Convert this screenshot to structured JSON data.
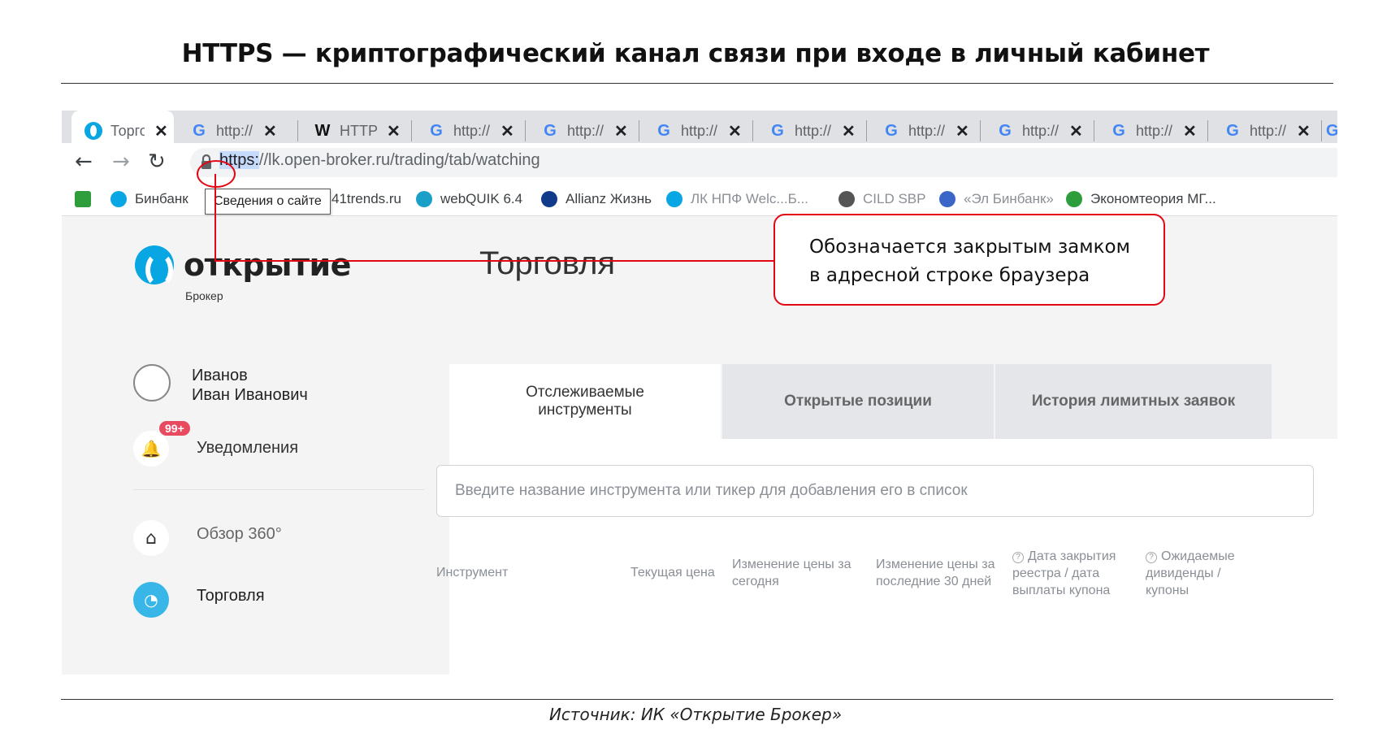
{
  "title": "HTTPS — криптографический канал связи при входе в личный кабинет",
  "source": "Источник: ИК «Открытие Брокер»",
  "browser": {
    "tabs": [
      {
        "icon": "otkritie-icon",
        "label": "Торговля",
        "active": true
      },
      {
        "icon": "google-icon",
        "label": "http://"
      },
      {
        "icon": "wikipedia-icon",
        "label": "HTTPS"
      },
      {
        "icon": "google-icon",
        "label": "http://"
      },
      {
        "icon": "google-icon",
        "label": "http://"
      },
      {
        "icon": "google-icon",
        "label": "http://"
      },
      {
        "icon": "google-icon",
        "label": "http://"
      },
      {
        "icon": "google-icon",
        "label": "http://"
      },
      {
        "icon": "google-icon",
        "label": "http://"
      },
      {
        "icon": "google-icon",
        "label": "http://"
      },
      {
        "icon": "google-icon",
        "label": "http://"
      }
    ],
    "url_scheme": "https:",
    "url_rest": "//lk.open-broker.ru/trading/tab/watching",
    "tooltip": "Сведения о сайте",
    "bookmarks": [
      {
        "label": "",
        "color": "#2e9e3c"
      },
      {
        "label": "Бинбанк",
        "color": "#08a6e3"
      },
      {
        "label": "41trends.ru",
        "color": ""
      },
      {
        "label": "webQUIK 6.4",
        "color": "#1aa0c8"
      },
      {
        "label": "Allianz Жизнь",
        "color": "#113b8a"
      },
      {
        "label": "ЛК НПФ Welc...Б...",
        "color": "#08a6e3"
      },
      {
        "label": "CILD SBP",
        "color": "#555555"
      },
      {
        "label": "«Эл Бинбанк»",
        "color": "#3a67c7"
      },
      {
        "label": "Экономтеория МГ...",
        "color": "#2e9e3c"
      }
    ]
  },
  "app": {
    "logo_text": "открытие",
    "logo_sub": "Брокер",
    "heading": "Торговля",
    "user_name_1": "Иванов",
    "user_name_2": "Иван Иванович",
    "badge": "99+",
    "notifications": "Уведомления",
    "overview": "Обзор 360°",
    "trading": "Торговля",
    "tabs": [
      "Отслеживаемые инструменты",
      "Открытые позиции",
      "История лимитных заявок"
    ],
    "search_placeholder": "Введите название инструмента или тикер для добавления его в список",
    "columns": [
      "Инструмент",
      "Текущая цена",
      "Изменение цены за сегодня",
      "Изменение цены за последние 30 дней",
      "Дата закрытия реестра / дата выплаты купона",
      "Ожидаемые дивиденды / купоны"
    ]
  },
  "callout": {
    "line1": "Обозначается закрытым замком",
    "line2": "в адресной строке браузера"
  },
  "colors": {
    "accent": "#08a6e3",
    "callout": "#e30613",
    "badge": "#e84a5f"
  }
}
